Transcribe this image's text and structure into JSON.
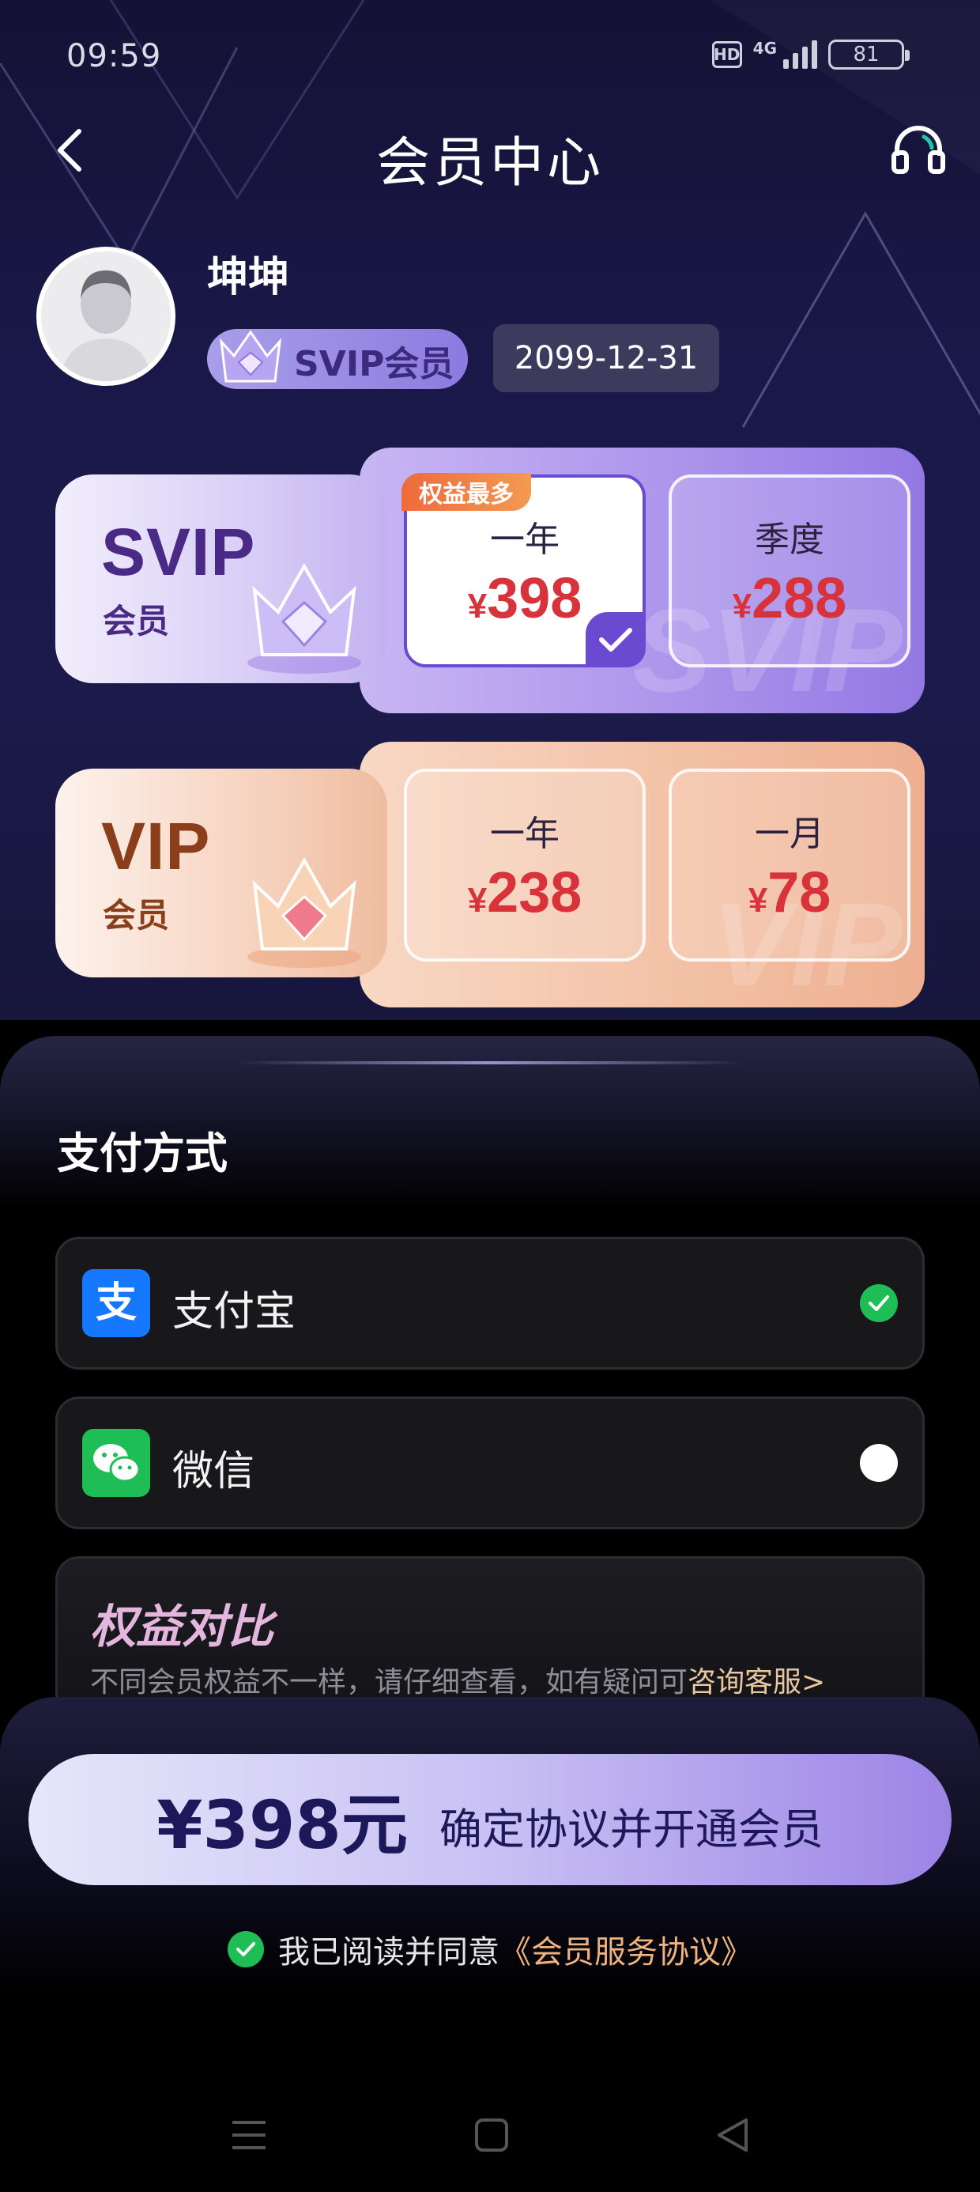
{
  "status_bar": {
    "time": "09:59",
    "network": "4G",
    "battery": "81"
  },
  "nav": {
    "title": "会员中心",
    "back_icon": "chevron-left-icon",
    "support_icon": "headset-icon"
  },
  "profile": {
    "username": "坤坤",
    "badge_label": "SVIP会员",
    "expire_date": "2099-12-31"
  },
  "plans": [
    {
      "name": "SVIP",
      "sub": "会员",
      "watermark": "SVIP",
      "tag": "权益最多",
      "options": [
        {
          "period": "一年",
          "currency": "¥",
          "price": "398",
          "selected": true
        },
        {
          "period": "季度",
          "currency": "¥",
          "price": "288",
          "selected": false
        }
      ]
    },
    {
      "name": "VIP",
      "sub": "会员",
      "watermark": "VIP",
      "options": [
        {
          "period": "一年",
          "currency": "¥",
          "price": "238",
          "selected": false
        },
        {
          "period": "一月",
          "currency": "¥",
          "price": "78",
          "selected": false
        }
      ]
    }
  ],
  "payment": {
    "title": "支付方式",
    "methods": [
      {
        "label": "支付宝",
        "icon": "alipay-icon",
        "selected": true
      },
      {
        "label": "微信",
        "icon": "wechat-icon",
        "selected": false
      }
    ]
  },
  "compare": {
    "title": "权益对比",
    "desc": "不同会员权益不一样，请仔细查看，如有疑问可",
    "link": "咨询客服>"
  },
  "cta": {
    "price": "¥398元",
    "label": "确定协议并开通会员"
  },
  "agreement": {
    "text": "我已阅读并同意",
    "link": "《会员服务协议》",
    "checked": true
  },
  "colors": {
    "accent_purple": "#6a4ad0",
    "price_red": "#d8323b",
    "alipay_blue": "#1677ff",
    "wechat_green": "#1ebd55",
    "link_orange": "#f0b27f"
  }
}
